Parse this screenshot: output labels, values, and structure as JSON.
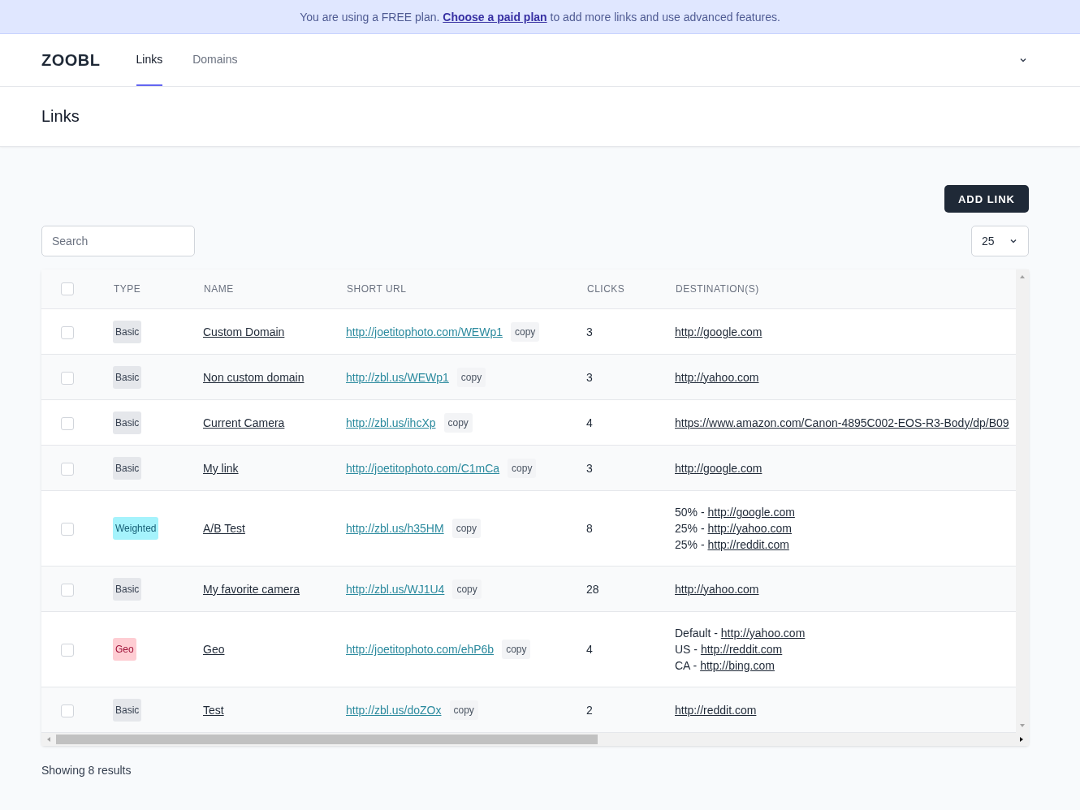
{
  "banner": {
    "before": "You are using a FREE plan.",
    "link": "Choose a paid plan",
    "after": "to add more links and use advanced features."
  },
  "nav": {
    "brand": "ZOOBL",
    "tabs": [
      {
        "label": "Links",
        "selected": true
      },
      {
        "label": "Domains",
        "selected": false
      }
    ]
  },
  "page_title": "Links",
  "add_button": "ADD LINK",
  "search": {
    "placeholder": "Search"
  },
  "per_page": "25",
  "table": {
    "all_checked": false,
    "columns": [
      "TYPE",
      "NAME",
      "SHORT URL",
      "CLICKS",
      "DESTINATION(S)"
    ],
    "rows": [
      {
        "checked": false,
        "type": {
          "label": "Basic",
          "kind": "basic"
        },
        "name": "Custom Domain",
        "short_url": "http://joetitophoto.com/WEWp1",
        "copy": "copy",
        "clicks": "3",
        "destinations": [
          {
            "url": "http://google.com"
          }
        ]
      },
      {
        "checked": false,
        "type": {
          "label": "Basic",
          "kind": "basic"
        },
        "name": "Non custom domain",
        "short_url": "http://zbl.us/WEWp1",
        "copy": "copy",
        "clicks": "3",
        "destinations": [
          {
            "url": "http://yahoo.com"
          }
        ]
      },
      {
        "checked": false,
        "type": {
          "label": "Basic",
          "kind": "basic"
        },
        "name": "Current Camera",
        "short_url": "http://zbl.us/ihcXp",
        "copy": "copy",
        "clicks": "4",
        "destinations": [
          {
            "url": "https://www.amazon.com/Canon-4895C002-EOS-R3-Body/dp/B09"
          }
        ]
      },
      {
        "checked": false,
        "type": {
          "label": "Basic",
          "kind": "basic"
        },
        "name": "My link",
        "short_url": "http://joetitophoto.com/C1mCa",
        "copy": "copy",
        "clicks": "3",
        "destinations": [
          {
            "url": "http://google.com"
          }
        ]
      },
      {
        "checked": false,
        "type": {
          "label": "Weighted",
          "kind": "weighted"
        },
        "name": "A/B Test",
        "short_url": "http://zbl.us/h35HM",
        "copy": "copy",
        "clicks": "8",
        "destinations": [
          {
            "prefix": "50% -",
            "url": "http://google.com"
          },
          {
            "prefix": "25% -",
            "url": "http://yahoo.com"
          },
          {
            "prefix": "25% -",
            "url": "http://reddit.com"
          }
        ]
      },
      {
        "checked": false,
        "type": {
          "label": "Basic",
          "kind": "basic"
        },
        "name": "My favorite camera",
        "short_url": "http://zbl.us/WJ1U4",
        "copy": "copy",
        "clicks": "28",
        "destinations": [
          {
            "url": "http://yahoo.com"
          }
        ]
      },
      {
        "checked": false,
        "type": {
          "label": "Geo",
          "kind": "geo"
        },
        "name": "Geo",
        "short_url": "http://joetitophoto.com/ehP6b",
        "copy": "copy",
        "clicks": "4",
        "destinations": [
          {
            "prefix": "Default -",
            "url": "http://yahoo.com"
          },
          {
            "prefix": "US -",
            "url": "http://reddit.com"
          },
          {
            "prefix": "CA -",
            "url": "http://bing.com"
          }
        ]
      },
      {
        "checked": false,
        "type": {
          "label": "Basic",
          "kind": "basic"
        },
        "name": "Test",
        "short_url": "http://zbl.us/doZOx",
        "copy": "copy",
        "clicks": "2",
        "destinations": [
          {
            "url": "http://reddit.com"
          }
        ]
      }
    ]
  },
  "footer": "Showing 8 results"
}
